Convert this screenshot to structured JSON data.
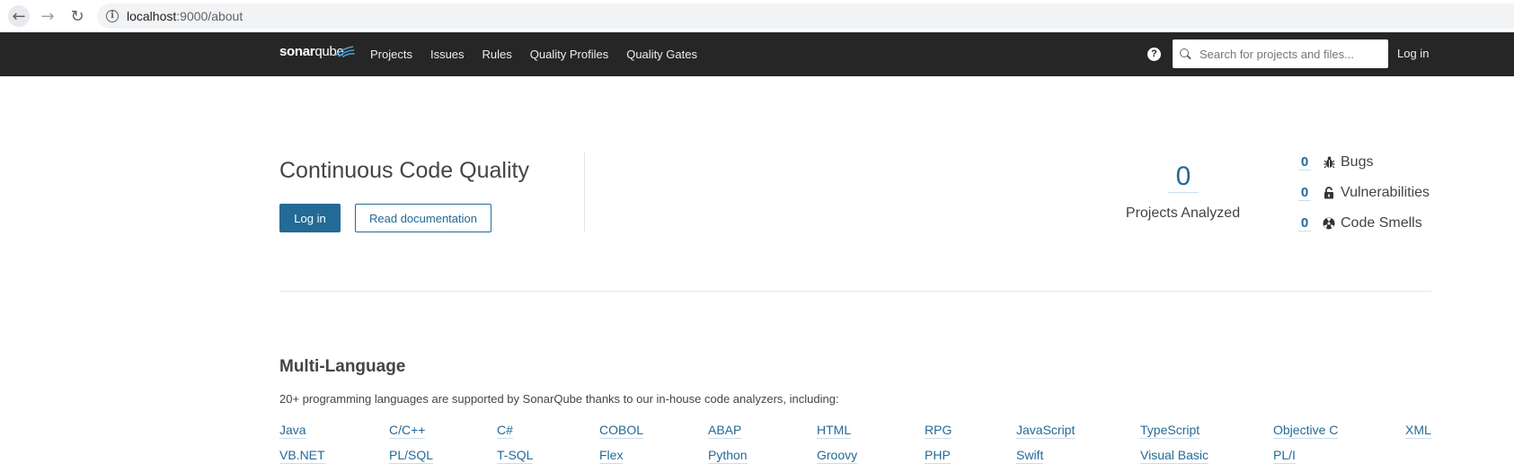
{
  "browser": {
    "url_host": "localhost",
    "url_path": ":9000/about"
  },
  "nav": {
    "logo_bold": "sonar",
    "logo_light": "qube",
    "links": [
      "Projects",
      "Issues",
      "Rules",
      "Quality Profiles",
      "Quality Gates"
    ],
    "search_placeholder": "Search for projects and files...",
    "login": "Log in"
  },
  "hero": {
    "title": "Continuous Code Quality",
    "login_button": "Log in",
    "docs_button": "Read documentation",
    "projects_count": "0",
    "projects_label": "Projects Analyzed",
    "issues": [
      {
        "count": "0",
        "label": "Bugs",
        "icon": "bug-icon"
      },
      {
        "count": "0",
        "label": "Vulnerabilities",
        "icon": "lock-icon"
      },
      {
        "count": "0",
        "label": "Code Smells",
        "icon": "code-smell-icon"
      }
    ]
  },
  "multi_language": {
    "title": "Multi-Language",
    "description": "20+ programming languages are supported by SonarQube thanks to our in-house code analyzers, including:",
    "languages_row1": [
      "Java",
      "C/C++",
      "C#",
      "COBOL",
      "ABAP",
      "HTML",
      "RPG",
      "JavaScript",
      "TypeScript",
      "Objective C",
      "XML"
    ],
    "languages_row2": [
      "VB.NET",
      "PL/SQL",
      "T-SQL",
      "Flex",
      "Python",
      "Groovy",
      "PHP",
      "Swift",
      "Visual Basic",
      "PL/I"
    ]
  },
  "colors": {
    "accent": "#236a97",
    "nav_bg": "#262626"
  }
}
